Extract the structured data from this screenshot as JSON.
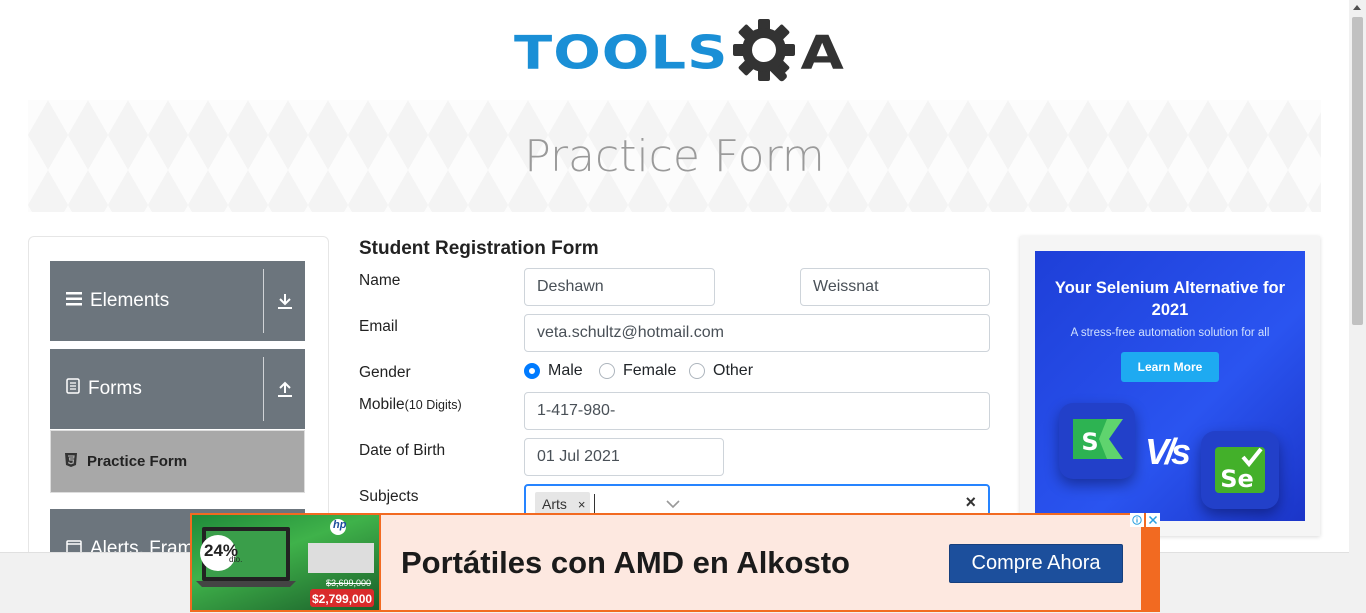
{
  "header": {
    "logo_text": "TOOLS",
    "logo_letter": "A"
  },
  "banner": {
    "title": "Practice Form"
  },
  "sidebar": {
    "groups": [
      {
        "label": "Elements",
        "icon": "list-icon",
        "toggle": "download-arrow-icon"
      },
      {
        "label": "Forms",
        "icon": "document-icon",
        "toggle": "upload-arrow-icon"
      },
      {
        "label": "Alerts, Fram",
        "icon": "window-icon"
      }
    ],
    "active_item": {
      "label": "Practice Form",
      "icon": "html5-icon"
    }
  },
  "form": {
    "title": "Student Registration Form",
    "name_label": "Name",
    "first_name": "Deshawn",
    "last_name": "Weissnat",
    "email_label": "Email",
    "email": "veta.schultz@hotmail.com",
    "gender_label": "Gender",
    "gender_options": [
      "Male",
      "Female",
      "Other"
    ],
    "gender_selected": "Male",
    "mobile_label": "Mobile",
    "mobile_hint": "(10 Digits)",
    "mobile": "1-417-980-",
    "dob_label": "Date of Birth",
    "dob": "01 Jul 2021",
    "subjects_label": "Subjects",
    "subjects": [
      "Arts"
    ],
    "chip_remove": "×",
    "clear_symbol": "×"
  },
  "side_ad": {
    "title": "Your Selenium Alternative for 2021",
    "subtitle": "A stress-free automation solution for all",
    "button": "Learn More",
    "vs_text": "V/s",
    "logo_left": "S",
    "logo_right": "Se"
  },
  "bottom_ad": {
    "text": "Portátiles con AMD en Alkosto",
    "button": "Compre Ahora",
    "discount": "24%",
    "discount_sub": "dto.",
    "old_price": "$3,699,000",
    "price": "$2,799,000",
    "brand": "hp"
  },
  "colors": {
    "brand_blue": "#1a8fd6",
    "sidebar_gray": "#6c757d",
    "active_item_bg": "#a8a8a8",
    "radio_blue": "#007bff",
    "ad_orange": "#f26a21",
    "ad_button": "#1c4f9c"
  }
}
